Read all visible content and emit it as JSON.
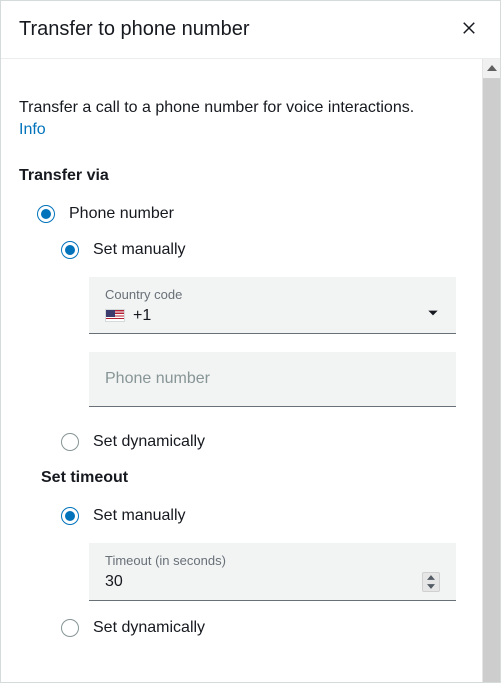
{
  "header": {
    "title": "Transfer to phone number"
  },
  "description": "Transfer a call to a phone number for voice interactions.",
  "info_link": "Info",
  "sections": {
    "transfer_via": {
      "label": "Transfer via",
      "option_phone": "Phone number",
      "set_manually": "Set manually",
      "set_dynamically": "Set dynamically",
      "country_code_label": "Country code",
      "country_code_value": "+1",
      "phone_placeholder": "Phone number"
    },
    "set_timeout": {
      "label": "Set timeout",
      "set_manually": "Set manually",
      "set_dynamically": "Set dynamically",
      "timeout_label": "Timeout (in seconds)",
      "timeout_value": "30"
    }
  }
}
